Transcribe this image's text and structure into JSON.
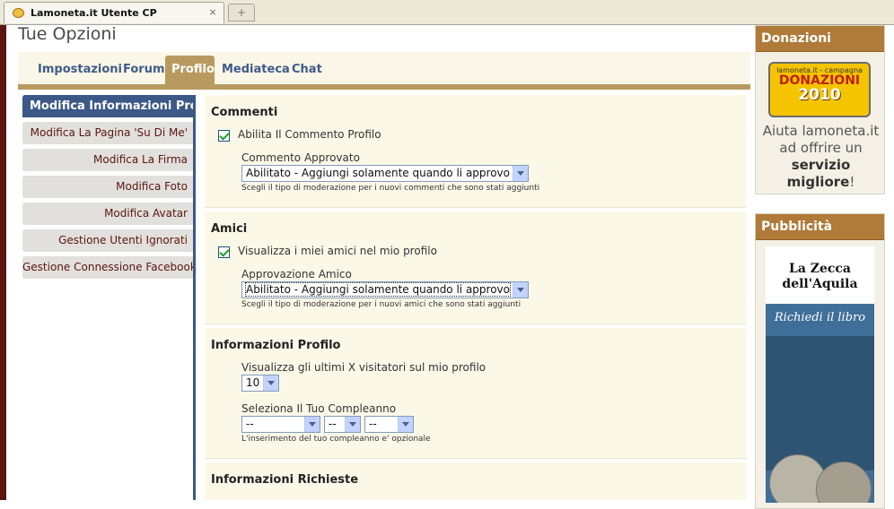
{
  "browser": {
    "tab_title": "Lamoneta.it Utente CP",
    "new_tab_glyph": "+"
  },
  "page": {
    "title": "Tue Opzioni"
  },
  "nav": {
    "tabs": [
      "Impostazioni",
      "Forum",
      "Profilo",
      "Mediateca",
      "Chat"
    ],
    "active": "Profilo"
  },
  "sidebar": {
    "items": [
      "Modifica Informazioni Profilo",
      "Modifica La Pagina 'Su Di Me'",
      "Modifica La Firma",
      "Modifica Foto",
      "Modifica Avatar",
      "Gestione Utenti Ignorati",
      "Gestione Connessione Facebook"
    ]
  },
  "sections": {
    "comments": {
      "title": "Commenti",
      "checkbox_label": "Abilita Il Commento Profilo",
      "field_label": "Commento Approvato",
      "select_value": "Abilitato - Aggiungi solamente quando li approvo",
      "hint": "Scegli il tipo di moderazione per i nuovi commenti che sono stati aggiunti"
    },
    "friends": {
      "title": "Amici",
      "checkbox_label": "Visualizza i miei amici nel mio profilo",
      "field_label": "Approvazione Amico",
      "select_value": "Abilitato - Aggiungi solamente quando li approvo",
      "hint": "Scegli il tipo di moderazione per i nuovi amici che sono stati aggiunti"
    },
    "profile_info": {
      "title": "Informazioni Profilo",
      "visitors_label": "Visualizza gli ultimi X visitatori sul mio profilo",
      "visitors_value": "10",
      "birthday_label": "Seleziona Il Tuo Compleanno",
      "birthday_month": "--",
      "birthday_day": "--",
      "birthday_year": "--",
      "birthday_hint": "L'inserimento del tuo compleanno e' opzionale"
    },
    "required_info": {
      "title": "Informazioni Richieste"
    }
  },
  "right": {
    "donations": {
      "title": "Donazioni",
      "badge_top": "lamoneta.it - campagna",
      "badge_main": "DONAZIONI",
      "badge_year": "2010",
      "text_line1": "Aiuta lamoneta.it",
      "text_line2": "ad offrire un",
      "text_bold1": "servizio",
      "text_bold2": "migliore",
      "text_end": "!"
    },
    "ads": {
      "title": "Pubblicità",
      "ad_line1": "La Zecca",
      "ad_line2": "dell'Aquila",
      "ad_line3": "Richiedi il libro"
    }
  },
  "colors": {
    "accent_brown": "#b89a60",
    "nav_blue": "#3b5887",
    "panel_header": "#b07a38"
  }
}
